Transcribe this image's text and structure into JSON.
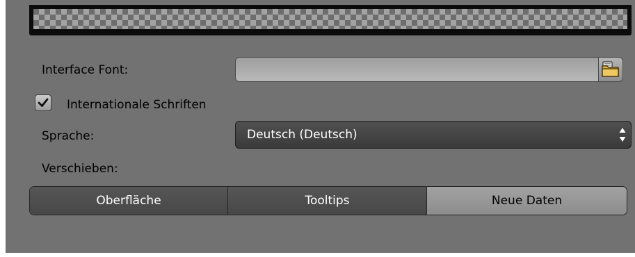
{
  "fonts": {
    "interface_font_label": "Interface Font:",
    "interface_font_value": "",
    "file_browse_icon": "folder-icon"
  },
  "international": {
    "label": "Internationale Schriften",
    "checked": true,
    "check_icon": "checkmark-icon"
  },
  "language": {
    "label": "Sprache:",
    "selected": "Deutsch (Deutsch)",
    "dropdown_icon": "up-down-arrows-icon"
  },
  "translate": {
    "label": "Verschieben:",
    "options": [
      {
        "label": "Oberfläche",
        "active": false
      },
      {
        "label": "Tooltips",
        "active": false
      },
      {
        "label": "Neue Daten",
        "active": true
      }
    ]
  },
  "colors": {
    "panel_bg": "#727272",
    "dropdown_bg": "#444444",
    "segment_dark": "#4e4e4e",
    "segment_active": "#999999"
  }
}
